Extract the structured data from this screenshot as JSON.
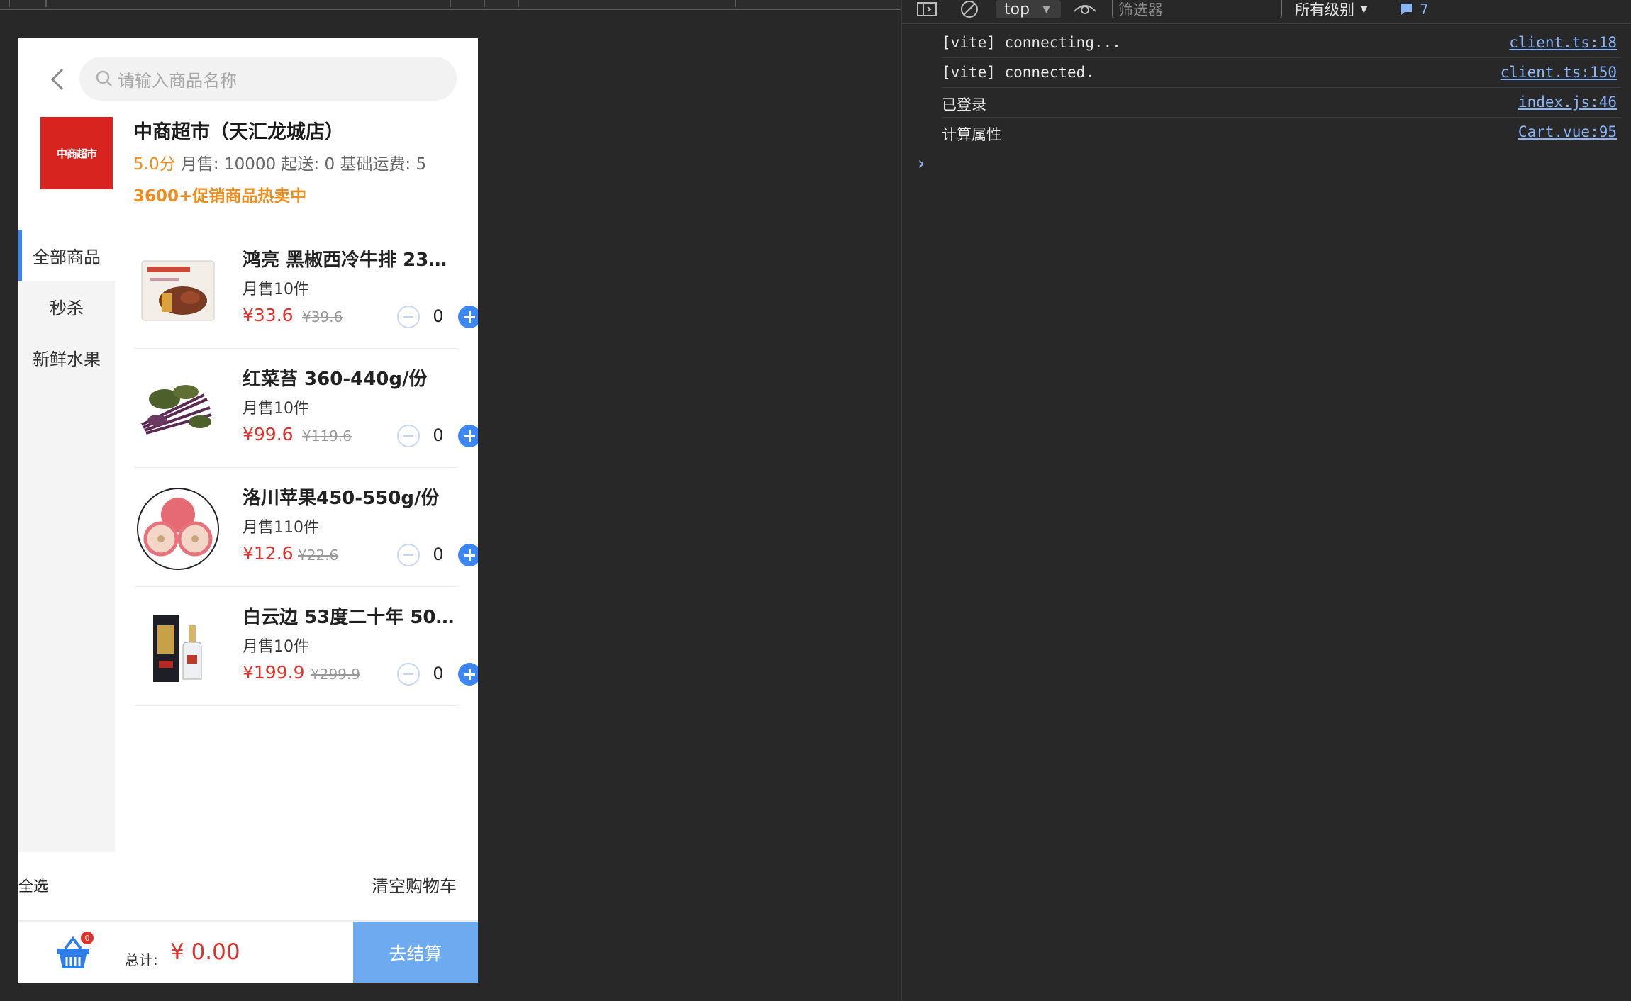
{
  "app": {
    "search_placeholder": "请输入商品名称",
    "store": {
      "logo_text": "中商超市",
      "name": "中商超市（天汇龙城店）",
      "score": "5.0分",
      "stats": "月售: 10000  起送: 0  基础运费: 5",
      "promo": "3600+促销商品热卖中"
    },
    "categories": [
      {
        "label": "全部商品",
        "active": true
      },
      {
        "label": "秒杀",
        "active": false
      },
      {
        "label": "新鲜水果",
        "active": false
      }
    ],
    "products": [
      {
        "name": "鸿亮 黑椒西冷牛排 230...",
        "sales": "月售10件",
        "price": "¥33.6",
        "orig_price": "¥39.6",
        "qty": "0",
        "thumb": "steak-package"
      },
      {
        "name": "红菜苔 360-440g/份",
        "sales": "月售10件",
        "price": "¥99.6",
        "orig_price": "¥119.6",
        "qty": "0",
        "thumb": "vegetable-bunch"
      },
      {
        "name": "洛川苹果450-550g/份",
        "sales": "月售110件",
        "price": "¥12.6",
        "orig_price": "¥22.6",
        "qty": "0",
        "thumb": "apple"
      },
      {
        "name": "白云边 53度二十年 500...",
        "sales": "月售10件",
        "price": "¥199.9",
        "orig_price": "¥299.9",
        "qty": "0",
        "thumb": "liquor-bottle"
      }
    ],
    "select_all": "全选",
    "clear_cart": "清空购物车",
    "cart_badge": "0",
    "total_label": "总计:",
    "total_value": "¥ 0.00",
    "checkout": "去结算",
    "colors": {
      "accent": "#3d87f5",
      "price": "#e0312b",
      "orange": "#f08c1c",
      "checkout": "#6daaf0"
    }
  },
  "devtools": {
    "context": "top",
    "filter_placeholder": "筛选器",
    "levels": "所有级别",
    "issues_count": "7",
    "logs": [
      {
        "message": "[vite] connecting...",
        "source": "client.ts:18"
      },
      {
        "message": "[vite] connected.",
        "source": "client.ts:150"
      },
      {
        "message": "已登录",
        "source": "index.js:46"
      },
      {
        "message": "计算属性",
        "source": "Cart.vue:95"
      }
    ]
  }
}
